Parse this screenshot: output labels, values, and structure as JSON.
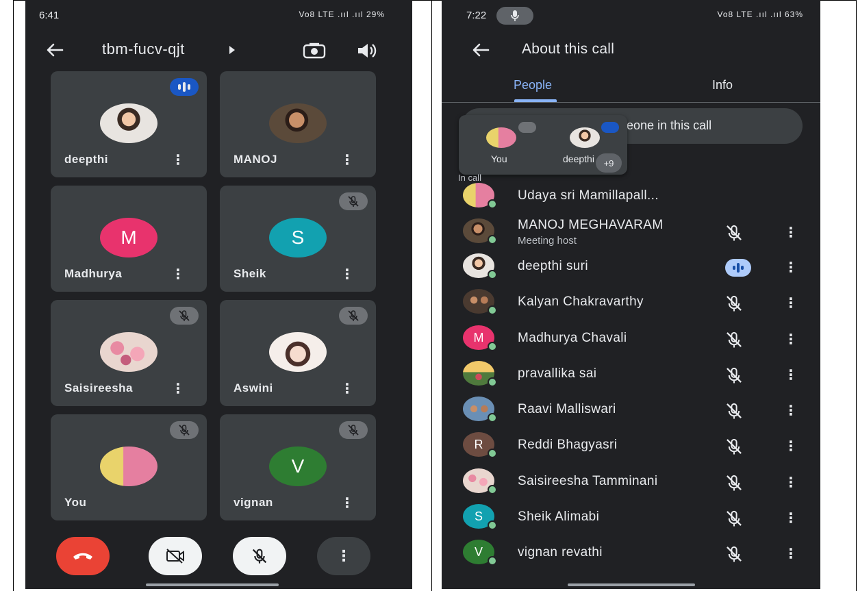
{
  "left": {
    "status": {
      "time": "6:41",
      "system": "Vo8 LTE .ııl .ııl 29%"
    },
    "meeting_code": "tbm-fucv-qjt",
    "tiles": [
      {
        "name": "deepthi",
        "avatar": "photo",
        "state": "speaking"
      },
      {
        "name": "MANOJ",
        "avatar": "photo",
        "state": "none"
      },
      {
        "name": "Madhurya",
        "avatar": "M",
        "avatar_color": "#e8336d",
        "state": "none"
      },
      {
        "name": "Sheik",
        "avatar": "S",
        "avatar_color": "#12a1b0",
        "state": "muted"
      },
      {
        "name": "Saisireesha",
        "avatar": "photo",
        "state": "muted"
      },
      {
        "name": "Aswini",
        "avatar": "photo",
        "state": "muted"
      },
      {
        "name": "You",
        "avatar": "photo",
        "state": "muted"
      },
      {
        "name": "vignan",
        "avatar": "V",
        "avatar_color": "#2e7d32",
        "state": "muted"
      }
    ],
    "controls": [
      "end-call",
      "camera-off",
      "mic-off",
      "more"
    ]
  },
  "right": {
    "status": {
      "time": "7:22",
      "system": "Vo8 LTE .ııl .ııl 63%"
    },
    "title": "About this call",
    "tabs": {
      "people": "People",
      "info": "Info"
    },
    "search_placeholder": "eone in this call",
    "popup": {
      "you": "You",
      "deepthi": "deepthi",
      "more": "+9"
    },
    "in_call_label": "In call",
    "participants": [
      {
        "name": "Udaya sri Mamillapall...",
        "sub": "",
        "avatar": "photo",
        "state": "none"
      },
      {
        "name": "MANOJ MEGHAVARAM",
        "sub": "Meeting host",
        "avatar": "photo",
        "state": "muted"
      },
      {
        "name": "deepthi suri",
        "sub": "",
        "avatar": "photo",
        "state": "speaking"
      },
      {
        "name": "Kalyan Chakravarthy",
        "sub": "",
        "avatar": "photo",
        "state": "muted"
      },
      {
        "name": "Madhurya Chavali",
        "sub": "",
        "avatar": "M",
        "avatar_color": "#e8336d",
        "state": "muted"
      },
      {
        "name": "pravallika sai",
        "sub": "",
        "avatar": "photo",
        "state": "muted"
      },
      {
        "name": "Raavi Malliswari",
        "sub": "",
        "avatar": "photo",
        "state": "muted"
      },
      {
        "name": "Reddi Bhagyasri",
        "sub": "",
        "avatar": "R",
        "avatar_color": "#6d4c41",
        "state": "muted"
      },
      {
        "name": "Saisireesha Tamminani",
        "sub": "",
        "avatar": "photo",
        "state": "muted"
      },
      {
        "name": "Sheik Alimabi",
        "sub": "",
        "avatar": "S",
        "avatar_color": "#12a1b0",
        "state": "muted"
      },
      {
        "name": "vignan revathi",
        "sub": "",
        "avatar": "V",
        "avatar_color": "#2e7d32",
        "state": "muted"
      }
    ]
  },
  "colors": {
    "background": "#202124",
    "tile": "#3c4043",
    "end_call": "#ea4335",
    "accent": "#8ab4f8",
    "online": "#81c995"
  }
}
